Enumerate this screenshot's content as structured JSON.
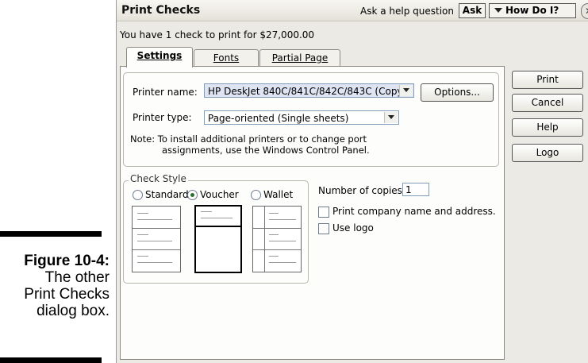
{
  "caption": {
    "figure_label": "Figure 10-4:",
    "lines": [
      "The other",
      "Print Checks",
      "dialog box."
    ]
  },
  "dialog": {
    "title": "Print Checks",
    "help_prompt": "Ask a help question",
    "ask_button": "Ask",
    "how_do_i_button": "How Do I?",
    "close_glyph": "✕",
    "summary": "You have 1 check to print for $27,000.00"
  },
  "tabs": [
    {
      "label": "Settings",
      "active": true
    },
    {
      "label": "Fonts",
      "active": false
    },
    {
      "label": "Partial Page",
      "active": false
    }
  ],
  "printer": {
    "name_label": "Printer name:",
    "name_value": "HP DeskJet 840C/841C/842C/843C (Copy",
    "options_button": "Options...",
    "type_label": "Printer type:",
    "type_value": "Page-oriented (Single sheets)",
    "note_line1": "Note: To install additional printers or to change port",
    "note_line2": "assignments, use the Windows Control Panel."
  },
  "check_style": {
    "legend": "Check Style",
    "options": [
      {
        "label": "Standard",
        "selected": false
      },
      {
        "label": "Voucher",
        "selected": true
      },
      {
        "label": "Wallet",
        "selected": false
      }
    ]
  },
  "copies": {
    "label": "Number of copies:",
    "value": "1",
    "print_company_label": "Print company name and address.",
    "print_company_checked": false,
    "use_logo_label": "Use logo",
    "use_logo_checked": false
  },
  "side_buttons": {
    "print": "Print",
    "cancel": "Cancel",
    "help": "Help",
    "logo": "Logo"
  }
}
